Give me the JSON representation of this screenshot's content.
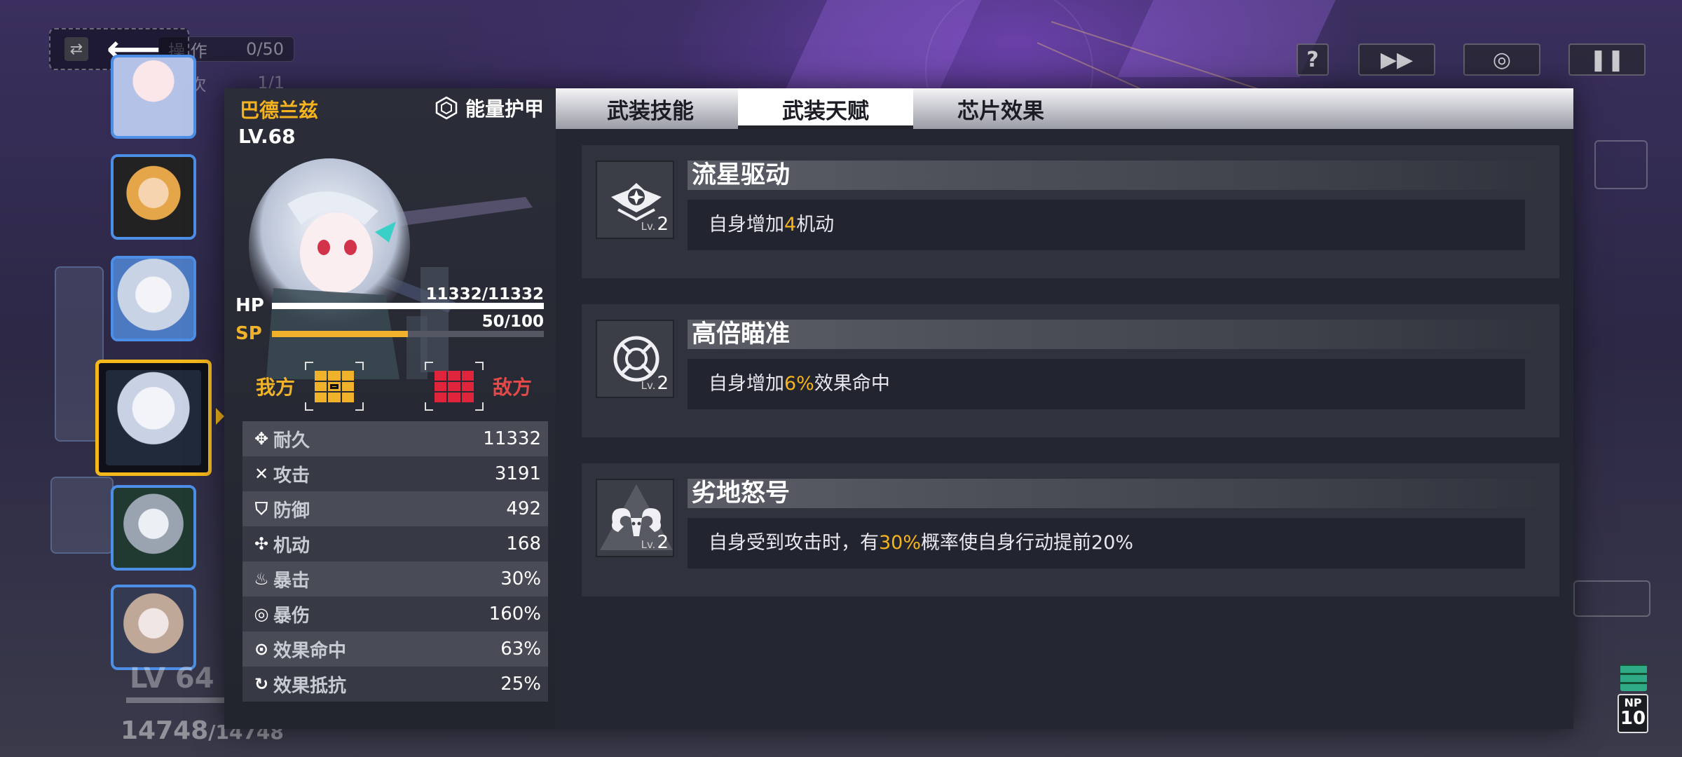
{
  "hud": {
    "ops_label": "操 作",
    "ops_value": "0/50",
    "wave_label": "波 次",
    "wave_value": "1/1",
    "help_glyph": "?",
    "bg_lv": "LV 64",
    "bg_hp_current": "14748",
    "bg_hp_max": "/14748",
    "np_label": "NP",
    "np_value": "10"
  },
  "character": {
    "name": "巴德兰兹",
    "level": "LV.68",
    "armor_label": "能量护甲",
    "hp_label": "HP",
    "hp_value": "11332/11332",
    "hp_fraction": 1.0,
    "sp_label": "SP",
    "sp_value": "50/100",
    "sp_fraction": 0.5,
    "ally_label": "我方",
    "enemy_label": "敌方"
  },
  "stats": [
    {
      "icon": "durability-icon",
      "label": "耐久",
      "value": "11332"
    },
    {
      "icon": "attack-icon",
      "label": "攻击",
      "value": "3191"
    },
    {
      "icon": "defense-icon",
      "label": "防御",
      "value": "492"
    },
    {
      "icon": "mobility-icon",
      "label": "机动",
      "value": "168"
    },
    {
      "icon": "crit-icon",
      "label": "暴击",
      "value": "30%"
    },
    {
      "icon": "crit-damage-icon",
      "label": "暴伤",
      "value": "160%"
    },
    {
      "icon": "effect-hit-icon",
      "label": "效果命中",
      "value": "63%"
    },
    {
      "icon": "effect-resist-icon",
      "label": "效果抵抗",
      "value": "25%"
    }
  ],
  "tabs": [
    {
      "label": "武装技能",
      "active": false
    },
    {
      "label": "武装天赋",
      "active": true
    },
    {
      "label": "芯片效果",
      "active": false
    }
  ],
  "talents": [
    {
      "icon": "meteor-wing-icon",
      "title": "流星驱动",
      "level_prefix": "Lv.",
      "level": "2",
      "desc_pre": "自身增加",
      "desc_hl": "4",
      "desc_post": "机动"
    },
    {
      "icon": "crosshair-icon",
      "title": "高倍瞄准",
      "level_prefix": "Lv.",
      "level": "2",
      "desc_pre": "自身增加",
      "desc_hl": "6%",
      "desc_post": "效果命中"
    },
    {
      "icon": "ram-horns-icon",
      "title": "劣地怒号",
      "level_prefix": "Lv.",
      "level": "2",
      "desc_pre": "自身受到攻击时，有",
      "desc_hl": "30%",
      "desc_post": "概率使自身行动提前20%"
    }
  ],
  "colors": {
    "accent_gold": "#f5b31e",
    "enemy_red": "#e24a4a",
    "ally_blue_border": "#4d8fe6",
    "active_border": "#f5b81c"
  }
}
